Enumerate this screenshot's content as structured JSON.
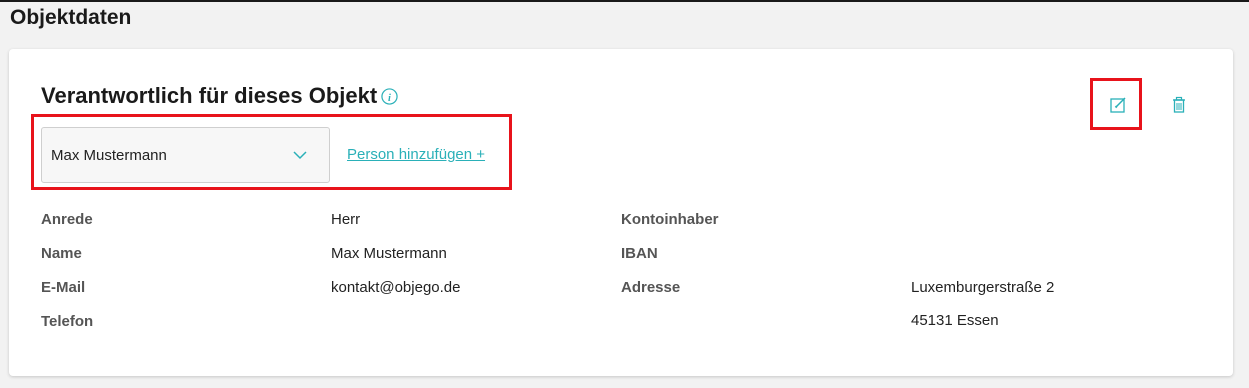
{
  "page": {
    "title": "Objektdaten"
  },
  "card": {
    "title": "Verantwortlich für dieses Objekt",
    "select_value": "Max Mustermann",
    "add_person_label": "Person hinzufügen +"
  },
  "details": {
    "left": [
      {
        "label": "Anrede",
        "value": "Herr"
      },
      {
        "label": "Name",
        "value": "Max Mustermann"
      },
      {
        "label": "E-Mail",
        "value": "kontakt@objego.de"
      },
      {
        "label": "Telefon",
        "value": ""
      }
    ],
    "right": [
      {
        "label": "Kontoinhaber",
        "value": ""
      },
      {
        "label": "IBAN",
        "value": ""
      },
      {
        "label": "Adresse",
        "value": "Luxemburgerstraße 2"
      },
      {
        "label": "",
        "value": "45131 Essen"
      }
    ]
  },
  "icons": {
    "info": "info-icon",
    "dropdown": "chevron-down-icon",
    "edit": "edit-icon",
    "delete": "trash-icon"
  },
  "colors": {
    "accent": "#2ab0b8",
    "highlight": "#e8131b",
    "background": "#f2f2f2",
    "card": "#ffffff"
  }
}
